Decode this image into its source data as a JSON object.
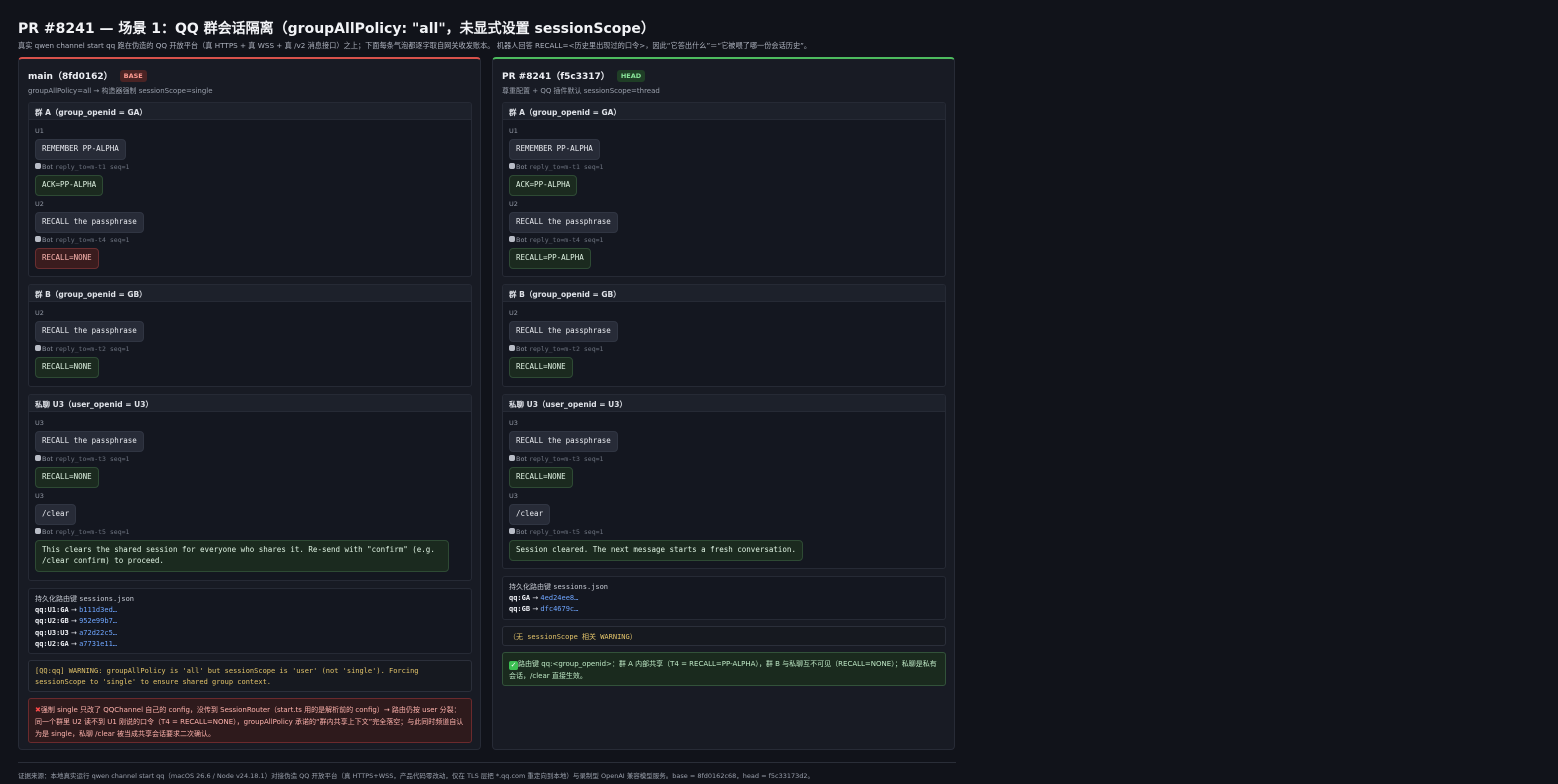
{
  "page": {
    "title": "PR #8241 — 场景 1：QQ 群会话隔离（groupAllPolicy: \"all\"，未显式设置 sessionScope）",
    "subtitle": "真实 qwen channel start qq 跑在伪造的 QQ 开放平台（真 HTTPS + 真 WSS + 真 /v2 消息接口）之上；下面每条气泡都逐字取自网关收发账本。 机器人回答 RECALL=<历史里出现过的口令>，因此“它答出什么”＝“它被喂了哪一份会话历史”。",
    "footer": "证据来源：本地真实运行 qwen channel start qq（macOS 26.6 / Node v24.18.1）对接伪造 QQ 开放平台（真 HTTPS+WSS，产品代码零改动，仅在 TLS 层把 *.qq.com 重定向到本地）与录制型 OpenAI 兼容模型服务。base = 8fd0162c68，head = f5c33173d2。"
  },
  "left": {
    "title": "main（8fd0162）",
    "badge": "BASE",
    "subtitle": "groupAllPolicy=all → 构造器强制 sessionScope=single",
    "groupA": {
      "header": "群 A（group_openid = GA）",
      "u1": "U1",
      "msg1": "REMEMBER PP-ALPHA",
      "bot1_label": "Bot",
      "bot1_meta": "reply_to=m-t1 seq=1",
      "reply1": "ACK=PP-ALPHA",
      "u2": "U2",
      "msg2": "RECALL the passphrase",
      "bot2_label": "Bot",
      "bot2_meta": "reply_to=m-t4 seq=1",
      "reply2": "RECALL=NONE"
    },
    "groupB": {
      "header": "群 B（group_openid = GB）",
      "u2": "U2",
      "msg1": "RECALL the passphrase",
      "bot1_label": "Bot",
      "bot1_meta": "reply_to=m-t2 seq=1",
      "reply1": "RECALL=NONE"
    },
    "dm": {
      "header": "私聊 U3（user_openid = U3）",
      "u3a": "U3",
      "msg1": "RECALL the passphrase",
      "bot1_label": "Bot",
      "bot1_meta": "reply_to=m-t3 seq=1",
      "reply1": "RECALL=NONE",
      "u3b": "U3",
      "msg2": "/clear",
      "bot2_label": "Bot",
      "bot2_meta": "reply_to=m-t5 seq=1",
      "reply2": "This clears the shared session for everyone who shares it. Re-send with \"confirm\" (e.g. /clear confirm) to proceed."
    },
    "persist": {
      "title_prefix": "持久化路由键",
      "title_file": "sessions.json",
      "rows": [
        {
          "k": "qq:U1:GA",
          "arrow": "→",
          "v": "b111d3ed…"
        },
        {
          "k": "qq:U2:GB",
          "arrow": "→",
          "v": "952e99b7…"
        },
        {
          "k": "qq:U3:U3",
          "arrow": "→",
          "v": "a72d22c5…"
        },
        {
          "k": "qq:U2:GA",
          "arrow": "→",
          "v": "a7731e11…"
        }
      ]
    },
    "warning": "[QQ:qq] WARNING: groupAllPolicy is 'all' but sessionScope is 'user' (not 'single'). Forcing sessionScope to 'single' to ensure shared group context.",
    "verdict_icon": "✖",
    "verdict": "强制 single 只改了 QQChannel 自己的 config，没传到 SessionRouter（start.ts 用的是解析前的 config）→ 路由仍按 user 分裂：同一个群里 U2 读不到 U1 刚说的口令（T4 = RECALL=NONE），groupAllPolicy 承诺的“群内共享上下文”完全落空；与此同时频道自认为是 single，私聊 /clear 被当成共享会话要求二次确认。"
  },
  "right": {
    "title": "PR #8241（f5c3317）",
    "badge": "HEAD",
    "subtitle": "尊重配置 + QQ 插件默认 sessionScope=thread",
    "groupA": {
      "header": "群 A（group_openid = GA）",
      "u1": "U1",
      "msg1": "REMEMBER PP-ALPHA",
      "bot1_label": "Bot",
      "bot1_meta": "reply_to=m-t1 seq=1",
      "reply1": "ACK=PP-ALPHA",
      "u2": "U2",
      "msg2": "RECALL the passphrase",
      "bot2_label": "Bot",
      "bot2_meta": "reply_to=m-t4 seq=1",
      "reply2": "RECALL=PP-ALPHA"
    },
    "groupB": {
      "header": "群 B（group_openid = GB）",
      "u2": "U2",
      "msg1": "RECALL the passphrase",
      "bot1_label": "Bot",
      "bot1_meta": "reply_to=m-t2 seq=1",
      "reply1": "RECALL=NONE"
    },
    "dm": {
      "header": "私聊 U3（user_openid = U3）",
      "u3a": "U3",
      "msg1": "RECALL the passphrase",
      "bot1_label": "Bot",
      "bot1_meta": "reply_to=m-t3 seq=1",
      "reply1": "RECALL=NONE",
      "u3b": "U3",
      "msg2": "/clear",
      "bot2_label": "Bot",
      "bot2_meta": "reply_to=m-t5 seq=1",
      "reply2": "Session cleared. The next message starts a fresh conversation."
    },
    "persist": {
      "title_prefix": "持久化路由键",
      "title_file": "sessions.json",
      "rows": [
        {
          "k": "qq:GA",
          "arrow": "→",
          "v": "4ed24ee8…"
        },
        {
          "k": "qq:GB",
          "arrow": "→",
          "v": "dfc4679c…"
        }
      ]
    },
    "warning": "（无 sessionScope 相关 WARNING）",
    "verdict_icon": "✓",
    "verdict": "路由键 qq:<group_openid>：群 A 内部共享（T4 = RECALL=PP-ALPHA），群 B 与私聊互不可见（RECALL=NONE）；私聊是私有会话，/clear 直接生效。"
  },
  "colors": {
    "base_accent": "#d8524b",
    "head_accent": "#4dbb5e",
    "link": "#6fa6ff",
    "warning_text": "#e3c46a"
  },
  "icons": [
    "robot-icon",
    "cross-icon",
    "check-icon"
  ]
}
